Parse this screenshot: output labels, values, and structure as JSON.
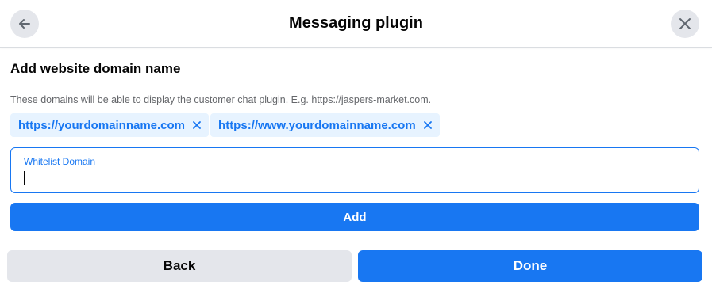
{
  "header": {
    "title": "Messaging plugin",
    "back_icon": "arrow-left-icon",
    "close_icon": "close-icon"
  },
  "section": {
    "title": "Add website domain name",
    "helper": "These domains will be able to display the customer chat plugin. E.g. https://jaspers-market.com."
  },
  "domains": [
    {
      "url": "https://yourdomainname.com",
      "remove_icon": "close-icon"
    },
    {
      "url": "https://www.yourdomainname.com",
      "remove_icon": "close-icon"
    }
  ],
  "input": {
    "label": "Whitelist Domain",
    "value": ""
  },
  "buttons": {
    "add": "Add",
    "back": "Back",
    "done": "Done"
  },
  "colors": {
    "accent": "#1877f2",
    "chip_bg": "#e7f3ff",
    "secondary_bg": "#e4e6eb",
    "muted_text": "#65676b"
  }
}
